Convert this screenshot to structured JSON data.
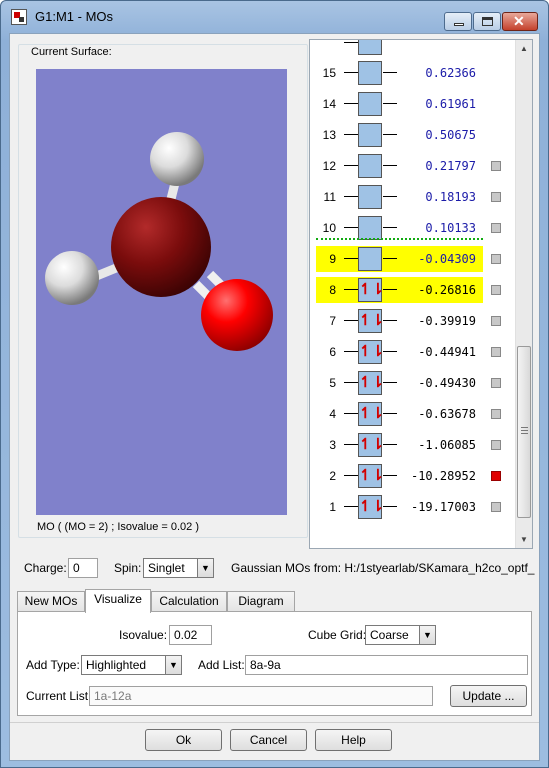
{
  "window": {
    "title": "G1:M1 - MOs"
  },
  "surface": {
    "group_label": "Current Surface:",
    "caption": "MO ( (MO = 2) ; Isovalue = 0.02 )"
  },
  "mo_list": [
    {
      "num": "15",
      "energy": "0.62366",
      "occupied": false,
      "visible": false,
      "highlighted": false
    },
    {
      "num": "14",
      "energy": "0.61961",
      "occupied": false,
      "visible": false,
      "highlighted": false
    },
    {
      "num": "13",
      "energy": "0.50675",
      "occupied": false,
      "visible": false,
      "highlighted": false
    },
    {
      "num": "12",
      "energy": "0.21797",
      "occupied": false,
      "visible": true,
      "highlighted": false
    },
    {
      "num": "11",
      "energy": "0.18193",
      "occupied": false,
      "visible": true,
      "highlighted": false
    },
    {
      "num": "10",
      "energy": "0.10133",
      "occupied": false,
      "visible": true,
      "highlighted": false
    },
    {
      "num": "9",
      "energy": "-0.04309",
      "occupied": false,
      "visible": true,
      "highlighted": true
    },
    {
      "num": "8",
      "energy": "-0.26816",
      "occupied": true,
      "visible": true,
      "highlighted": true
    },
    {
      "num": "7",
      "energy": "-0.39919",
      "occupied": true,
      "visible": true,
      "highlighted": false
    },
    {
      "num": "6",
      "energy": "-0.44941",
      "occupied": true,
      "visible": true,
      "highlighted": false
    },
    {
      "num": "5",
      "energy": "-0.49430",
      "occupied": true,
      "visible": true,
      "highlighted": false
    },
    {
      "num": "4",
      "energy": "-0.63678",
      "occupied": true,
      "visible": true,
      "highlighted": false
    },
    {
      "num": "3",
      "energy": "-1.06085",
      "occupied": true,
      "visible": true,
      "highlighted": false
    },
    {
      "num": "2",
      "energy": "-10.28952",
      "occupied": true,
      "visible": true,
      "highlighted": false,
      "selected": true
    },
    {
      "num": "1",
      "energy": "-19.17003",
      "occupied": true,
      "visible": true,
      "highlighted": false
    }
  ],
  "info": {
    "charge_label": "Charge:",
    "charge_value": "0",
    "spin_label": "Spin:",
    "spin_value": "Singlet",
    "source_text": "Gaussian MOs from:  H:/1styearlab/SKamara_h2co_optf_"
  },
  "tabs": [
    "New MOs",
    "Visualize",
    "Calculation",
    "Diagram"
  ],
  "visualize": {
    "isovalue_label": "Isovalue:",
    "isovalue_value": "0.02",
    "cube_grid_label": "Cube Grid:",
    "cube_grid_value": "Coarse",
    "add_type_label": "Add Type:",
    "add_type_value": "Highlighted",
    "add_list_label": "Add List:",
    "add_list_value": "8a-9a",
    "current_list_label": "Current List:",
    "current_list_value": "1a-12a",
    "update_label": "Update ..."
  },
  "buttons": {
    "ok": "Ok",
    "cancel": "Cancel",
    "help": "Help"
  },
  "colors": {
    "highlight": "#ffff00",
    "selected_check": "#e00000",
    "viewer_bg": "#8081cb",
    "mo_box": "#9fc2e5"
  }
}
